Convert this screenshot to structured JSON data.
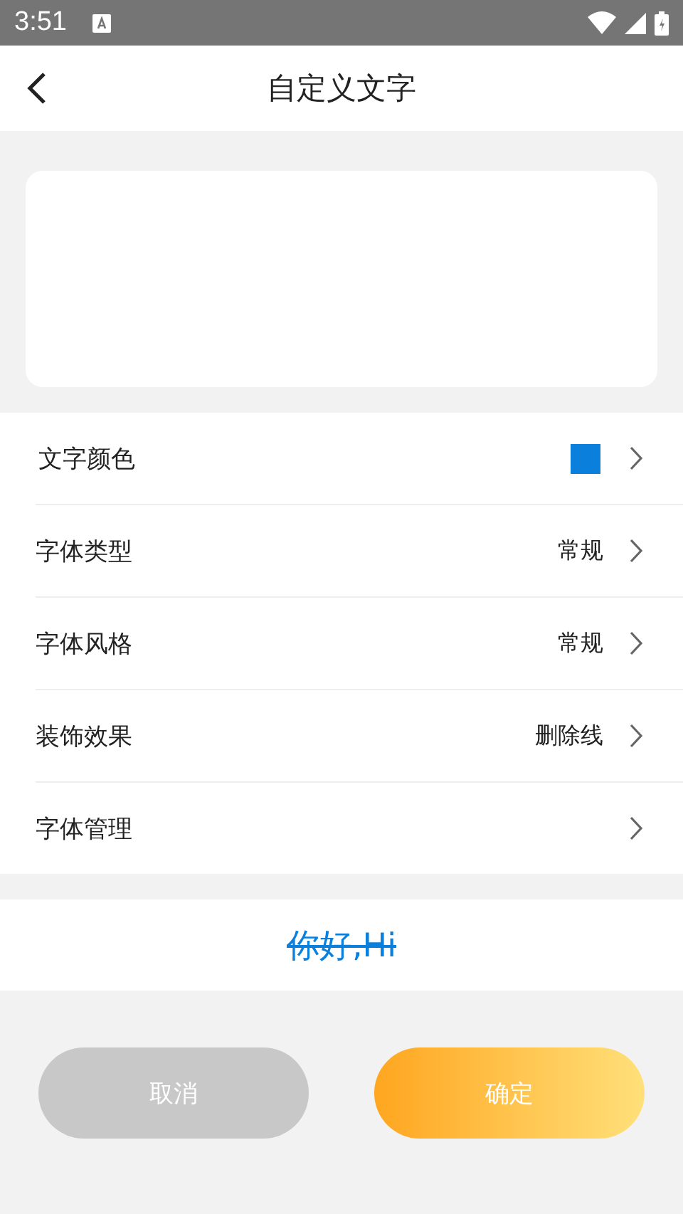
{
  "status_bar": {
    "time": "3:51"
  },
  "header": {
    "title": "自定义文字"
  },
  "settings": [
    {
      "kind": "swatch",
      "label": "文字颜色",
      "color": "#0a7fdc"
    },
    {
      "kind": "value",
      "label": "字体类型",
      "value": "常规"
    },
    {
      "kind": "value",
      "label": "字体风格",
      "value": "常规"
    },
    {
      "kind": "value",
      "label": "装饰效果",
      "value": "删除线"
    },
    {
      "kind": "plain",
      "label": "字体管理"
    }
  ],
  "preview": {
    "text": "你好,Hi",
    "strikethrough": true
  },
  "buttons": [
    {
      "kind": "cancel",
      "label": "取消"
    },
    {
      "kind": "confirm",
      "label": "确定"
    }
  ]
}
